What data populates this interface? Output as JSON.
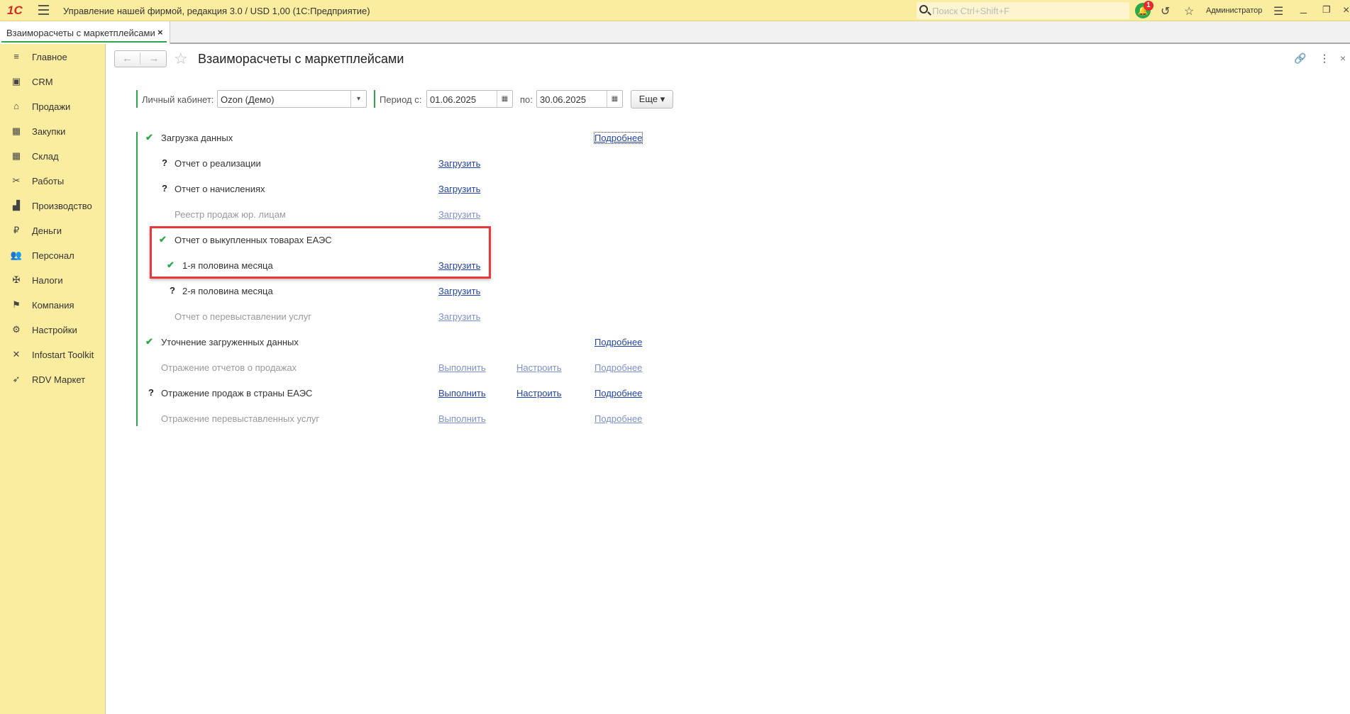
{
  "app": {
    "logo": "1С",
    "title": "Управление нашей фирмой, редакция 3.0 / USD 1,00  (1С:Предприятие)",
    "search_placeholder": "Поиск Ctrl+Shift+F",
    "notifications_count": "1",
    "user": "Администратор"
  },
  "tabs": [
    {
      "label": "Взаиморасчеты с маркетплейсами",
      "close": "×"
    }
  ],
  "sidebar": {
    "items": [
      {
        "label": "Главное",
        "icon": "≡"
      },
      {
        "label": "CRM",
        "icon": "▣"
      },
      {
        "label": "Продажи",
        "icon": "⌂"
      },
      {
        "label": "Закупки",
        "icon": "▦"
      },
      {
        "label": "Склад",
        "icon": "▦"
      },
      {
        "label": "Работы",
        "icon": "✂"
      },
      {
        "label": "Производство",
        "icon": "▟"
      },
      {
        "label": "Деньги",
        "icon": "₽"
      },
      {
        "label": "Персонал",
        "icon": "👥"
      },
      {
        "label": "Налоги",
        "icon": "✠"
      },
      {
        "label": "Компания",
        "icon": "⚑"
      },
      {
        "label": "Настройки",
        "icon": "⚙"
      },
      {
        "label": "Infostart Toolkit",
        "icon": "✕"
      },
      {
        "label": "RDV Маркет",
        "icon": "➶"
      }
    ]
  },
  "page": {
    "title": "Взаиморасчеты с маркетплейсами"
  },
  "filters": {
    "cabinet_label": "Личный кабинет:",
    "cabinet_value": "Ozon (Демо)",
    "period_from_label": "Период с:",
    "period_from": "01.06.2025",
    "period_to_label": "по:",
    "period_to": "30.06.2025",
    "more_label": "Еще"
  },
  "rows": [
    {
      "level": 1,
      "status": "check",
      "text": "Загрузка данных",
      "enabled": true,
      "more": "Подробнее"
    },
    {
      "level": 2,
      "status": "question",
      "text": "Отчет о реализации",
      "enabled": true,
      "action": "Загрузить"
    },
    {
      "level": 2,
      "status": "question",
      "text": "Отчет о начислениях",
      "enabled": true,
      "action": "Загрузить"
    },
    {
      "level": 2,
      "status": "none",
      "text": "Реестр продаж юр. лицам",
      "enabled": false,
      "action": "Загрузить"
    },
    {
      "level": 2,
      "status": "check",
      "text": "Отчет о выкупленных товарах ЕАЭС",
      "enabled": true
    },
    {
      "level": 3,
      "status": "check",
      "text": "1-я половина месяца",
      "enabled": true,
      "action": "Загрузить"
    },
    {
      "level": 3,
      "status": "question",
      "text": "2-я половина месяца",
      "enabled": true,
      "action": "Загрузить"
    },
    {
      "level": 2,
      "status": "none",
      "text": "Отчет о перевыставлении услуг",
      "enabled": false,
      "action": "Загрузить"
    },
    {
      "level": 1,
      "status": "check",
      "text": "Уточнение загруженных данных",
      "enabled": true,
      "more": "Подробнее"
    },
    {
      "level": 1,
      "status": "none",
      "text": "Отражение отчетов о продажах",
      "enabled": false,
      "action": "Выполнить",
      "setup": "Настроить",
      "more": "Подробнее"
    },
    {
      "level": 1,
      "status": "question",
      "text": "Отражение продаж в страны ЕАЭС",
      "enabled": true,
      "action": "Выполнить",
      "setup": "Настроить",
      "more": "Подробнее"
    },
    {
      "level": 1,
      "status": "none",
      "text": "Отражение перевыставленных услуг",
      "enabled": false,
      "action": "Выполнить",
      "more": "Подробнее"
    }
  ],
  "highlight_color": "#e8393b",
  "accent": "#2aa84a"
}
